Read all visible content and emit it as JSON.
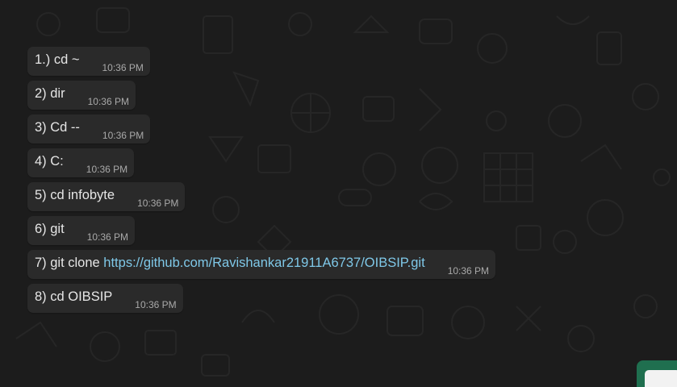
{
  "messages": [
    {
      "text": "1.) cd ~",
      "time": "10:36 PM"
    },
    {
      "text": "2) dir",
      "time": "10:36 PM"
    },
    {
      "text": "3) Cd --",
      "time": "10:36 PM"
    },
    {
      "text": "4) C:",
      "time": "10:36 PM"
    },
    {
      "text": "5) cd infobyte",
      "time": "10:36 PM"
    },
    {
      "text": "6) git",
      "time": "10:36 PM"
    },
    {
      "text_prefix": "7) git clone ",
      "link": "https://github.com/Ravishankar21911A6737/OIBSIP.git",
      "time": "10:36 PM"
    },
    {
      "text": "8) cd OIBSIP",
      "time": "10:36 PM"
    }
  ],
  "colors": {
    "background": "#1c1c1c",
    "bubble": "#2a2a2a",
    "text": "#e6e6e6",
    "timestamp": "#a9a9a9",
    "link": "#7fc8e8",
    "scroll_button": "#1f6f4f"
  },
  "icons": {
    "scroll_button": "scroll-to-bottom-icon"
  }
}
